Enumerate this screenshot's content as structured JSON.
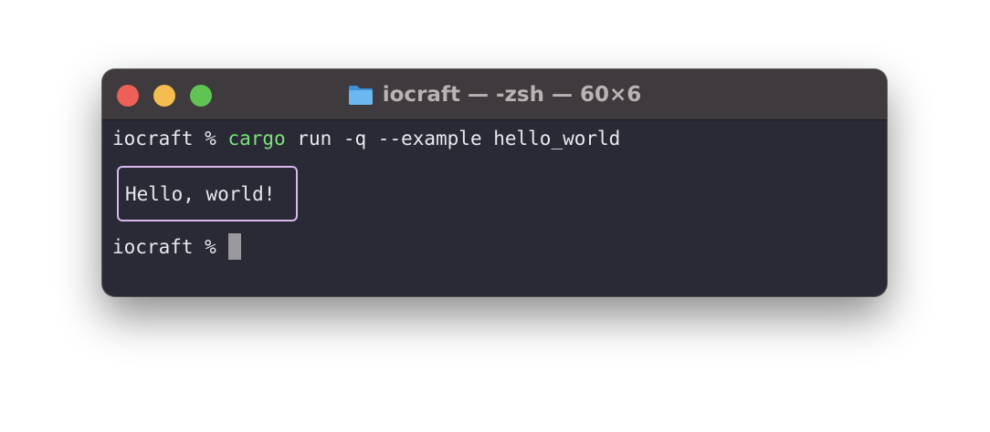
{
  "window": {
    "title": "iocraft — -zsh — 60×6"
  },
  "traffic_lights": {
    "close": "#ed5f57",
    "minimize": "#f5bd4f",
    "zoom": "#5fc454"
  },
  "terminal": {
    "line1": {
      "prompt": "iocraft % ",
      "command": "cargo",
      "args": " run -q --example hello_world"
    },
    "output_box_text": "Hello, world!",
    "line3": {
      "prompt": "iocraft % "
    }
  },
  "icons": {
    "title_icon": "folder-icon"
  },
  "colors": {
    "terminal_bg": "#2a2a36",
    "titlebar_bg": "#3e3a3d",
    "command_green": "#7be27b",
    "box_border": "#d9b8ee",
    "folder_blue": "#5aa8e6"
  }
}
